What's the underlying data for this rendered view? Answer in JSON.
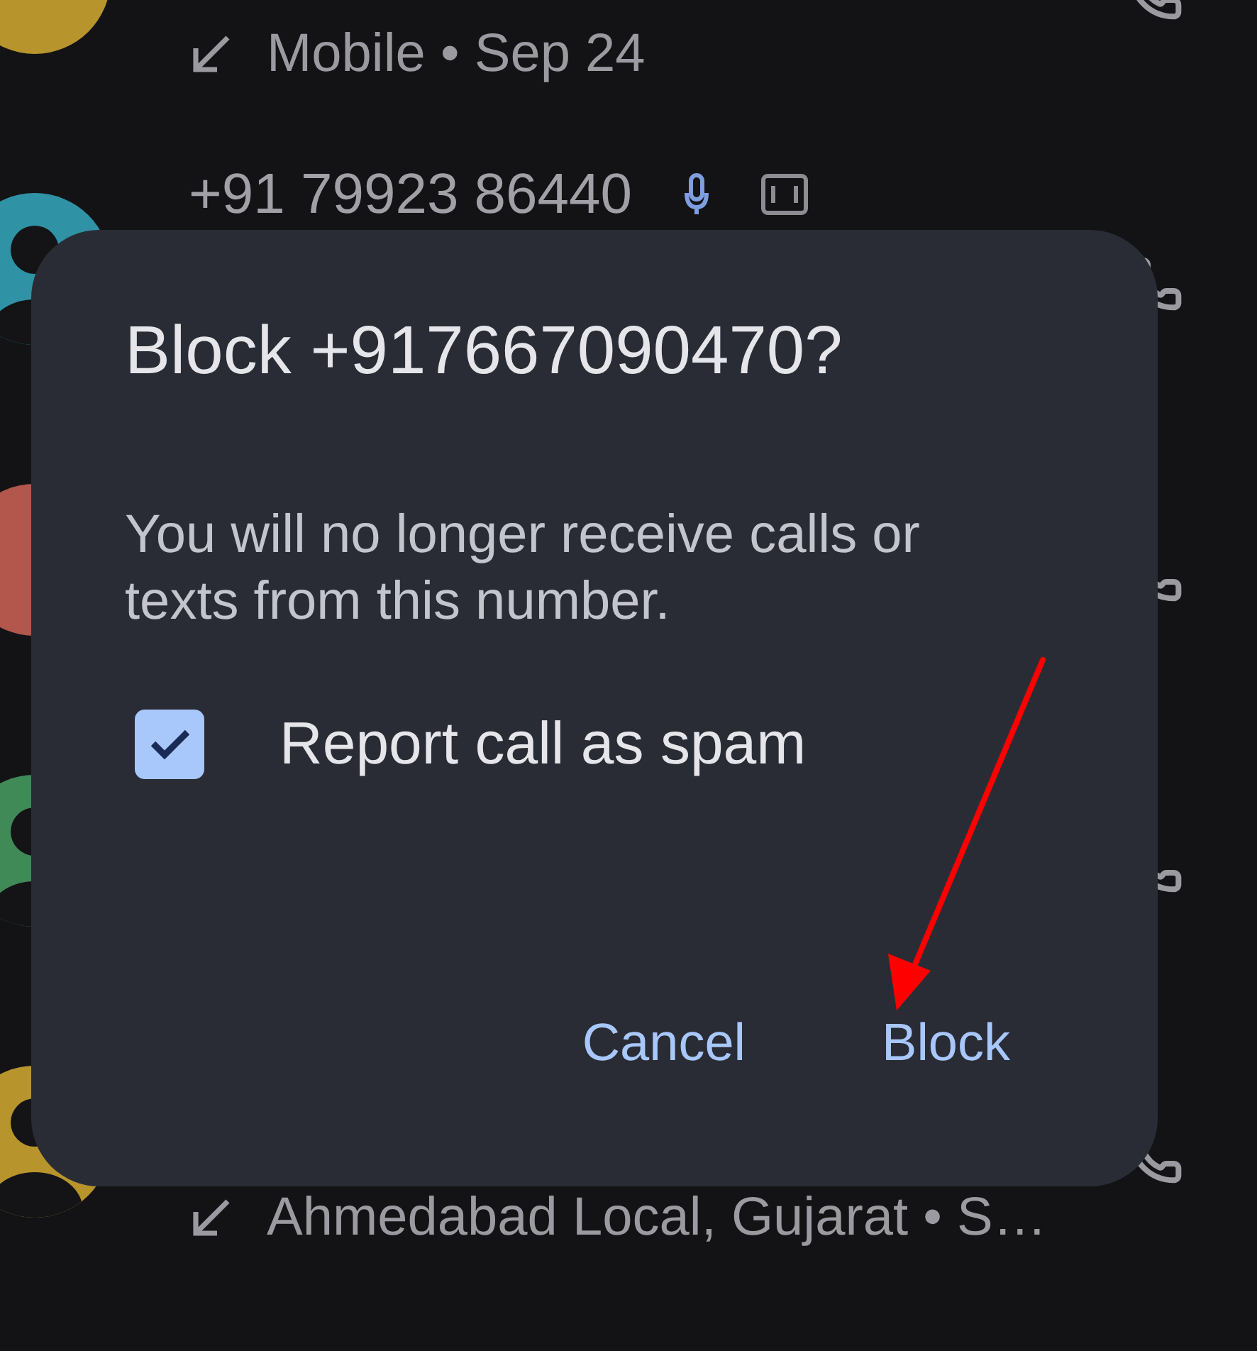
{
  "call_log": [
    {
      "avatar": {
        "kind": "letter",
        "color": "#b8952c"
      },
      "incoming": true,
      "subtitle": "Mobile • Sep 24"
    },
    {
      "avatar": {
        "kind": "person",
        "color": "#2f93a5"
      },
      "title": "+91 79923 86440",
      "mic_badge": true,
      "hd_badge": true
    },
    {
      "avatar": {
        "kind": "letter",
        "color": "#b3564b"
      }
    },
    {
      "avatar": {
        "kind": "person",
        "color": "#3f8a57"
      }
    },
    {
      "avatar": {
        "kind": "person",
        "color": "#b8952c"
      },
      "incoming": true,
      "subtitle": "Ahmedabad Local, Gujarat • S…"
    }
  ],
  "dialog": {
    "title": "Block +917667090470?",
    "message": "You will no longer receive calls or texts from this number.",
    "checkbox": {
      "label": "Report call as spam",
      "checked": true
    },
    "buttons": [
      {
        "label": "Cancel"
      },
      {
        "label": "Block"
      }
    ]
  }
}
